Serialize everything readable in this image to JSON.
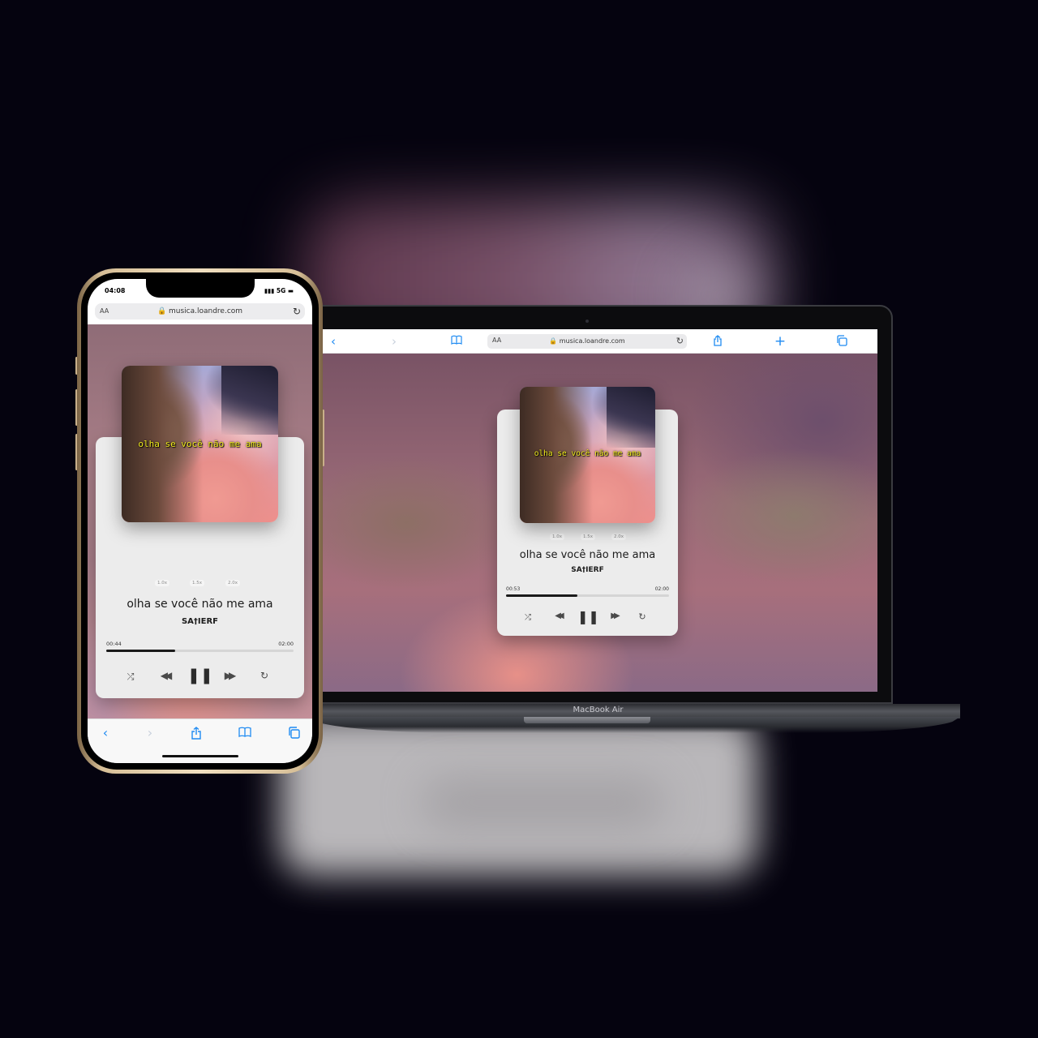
{
  "mac": {
    "label": "MacBook Air",
    "toolbar": {
      "back_icon": "‹",
      "forward_icon": "›",
      "bookmarks_icon": "📖",
      "text_size": "AA",
      "url": "🔒 musica.loandre.com",
      "reload_icon": "↻",
      "share_icon": "⇪",
      "new_tab_icon": "+",
      "tabs_icon": "⧉"
    },
    "player": {
      "lyric_overlay": "olha se você não me ama",
      "speeds": [
        "1.0x",
        "1.5x",
        "2.0x"
      ],
      "title": "olha se você não me ama",
      "artist": "SA†IERF",
      "elapsed": "00:53",
      "duration": "02:00",
      "progress": 0.44,
      "controls": {
        "shuffle": "⤮",
        "rewind": "◀◀",
        "pause": "❚❚",
        "forward": "▶▶",
        "repeat": "↻"
      }
    }
  },
  "phone": {
    "status_time": "04:08",
    "status_right": "▮▮▮ 5G ▬",
    "url_bar": {
      "text_size": "AA",
      "url": "🔒 musica.loandre.com",
      "reload_icon": "↻"
    },
    "player": {
      "lyric_overlay": "olha se você não me ama",
      "speeds": [
        "1.0x",
        "1.5x",
        "2.0x"
      ],
      "title": "olha se você não me ama",
      "artist": "SA†IERF",
      "elapsed": "00:44",
      "duration": "02:00",
      "progress": 0.37,
      "controls": {
        "shuffle": "⤮",
        "rewind": "◀◀",
        "pause": "❚❚",
        "forward": "▶▶",
        "repeat": "↻"
      }
    },
    "bottom_bar": {
      "back_icon": "‹",
      "forward_icon": "›",
      "share_icon": "⇪",
      "bookmarks_icon": "📖",
      "tabs_icon": "⧉"
    }
  },
  "colors": {
    "accent": "#1f8bf2",
    "lyric": "#f2ec1e",
    "card": "#ececec",
    "background": "#05030f"
  }
}
